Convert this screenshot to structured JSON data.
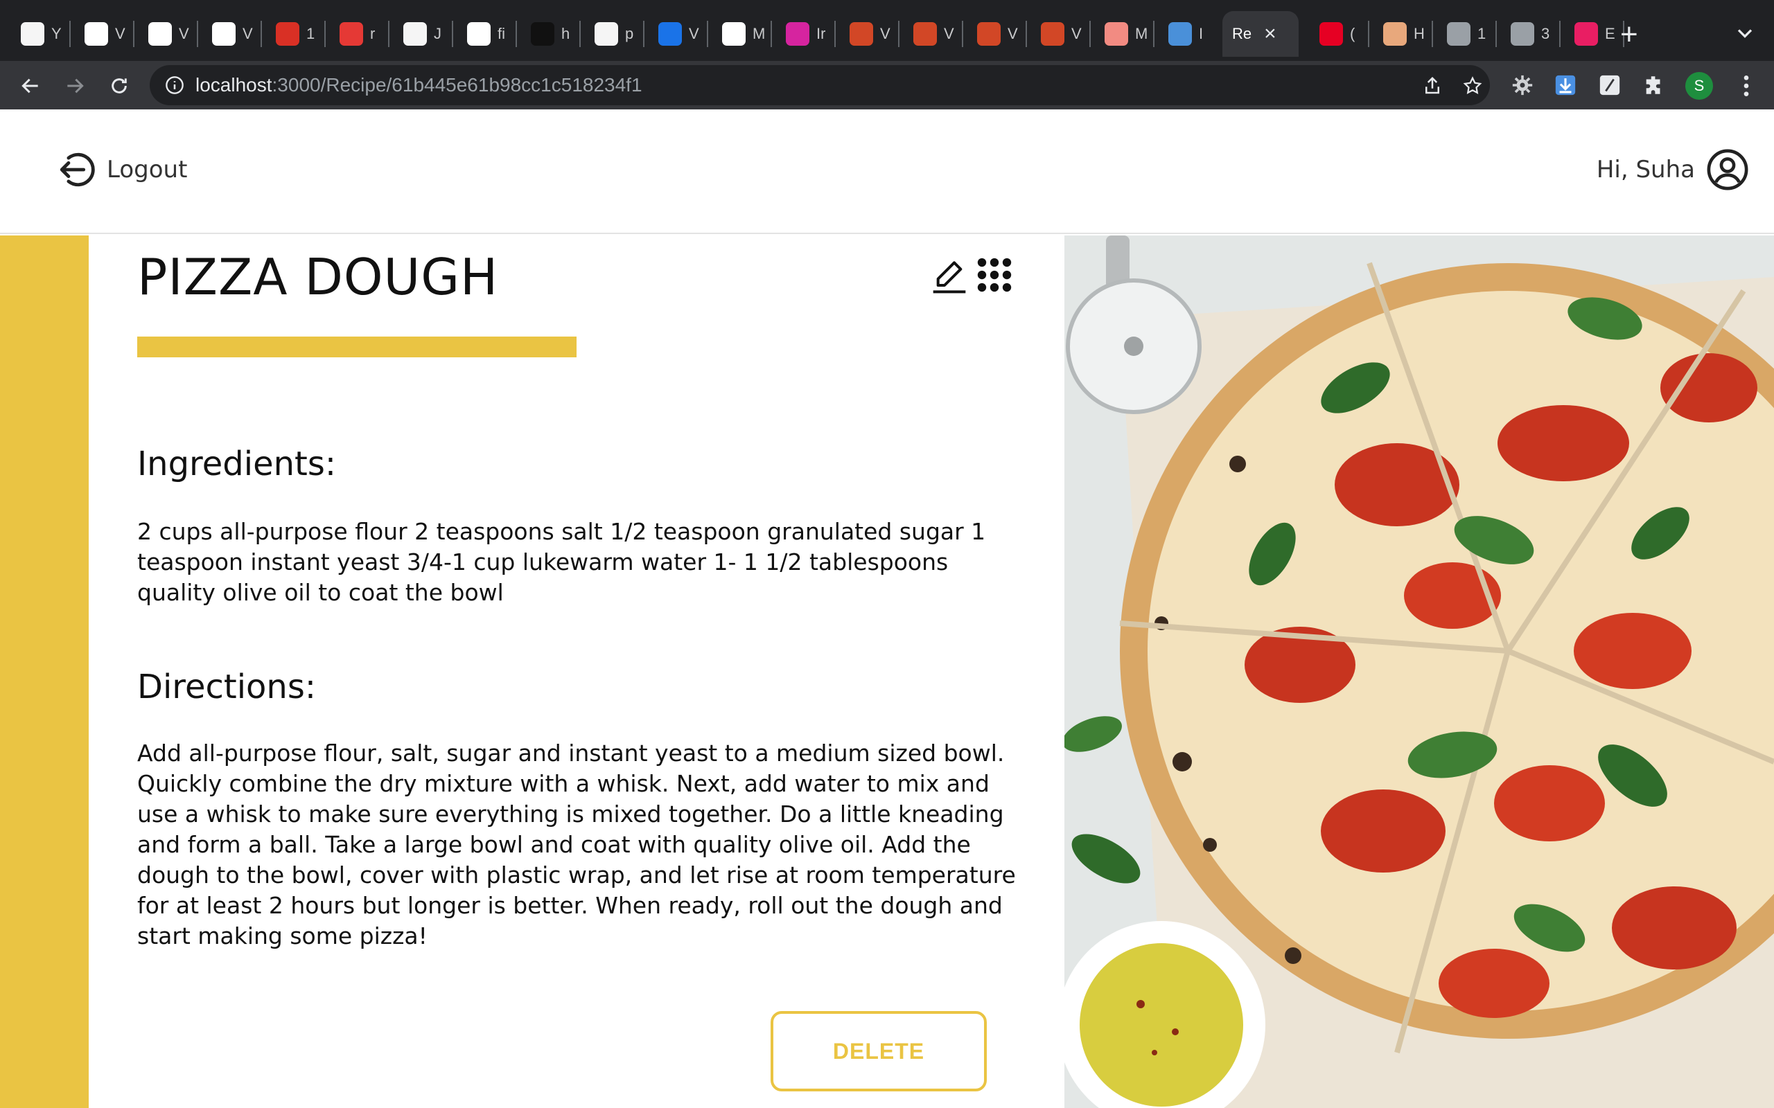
{
  "browser": {
    "tabs": [
      {
        "label": "Y",
        "icon": "github-icon",
        "color": "#f5f5f5"
      },
      {
        "label": "V",
        "icon": "wix-icon",
        "color": "#ffffff"
      },
      {
        "label": "V",
        "icon": "wix-icon",
        "color": "#ffffff"
      },
      {
        "label": "V",
        "icon": "wix-icon",
        "color": "#ffffff"
      },
      {
        "label": "1",
        "icon": "shield-icon",
        "color": "#d93025"
      },
      {
        "label": "r",
        "icon": "n-logo-icon",
        "color": "#e53935"
      },
      {
        "label": "J",
        "icon": "github-icon",
        "color": "#f5f5f5"
      },
      {
        "label": "fi",
        "icon": "figma-icon",
        "color": "#ffffff"
      },
      {
        "label": "h",
        "icon": "p-logo-icon",
        "color": "#111111"
      },
      {
        "label": "p",
        "icon": "github-icon",
        "color": "#f5f5f5"
      },
      {
        "label": "V",
        "icon": "globe-blue-icon",
        "color": "#1a73e8"
      },
      {
        "label": "M",
        "icon": "mail-icon",
        "color": "#ffffff"
      },
      {
        "label": "Ir",
        "icon": "instagram-icon",
        "color": "#d6249f"
      },
      {
        "label": "V",
        "icon": "powerpoint-icon",
        "color": "#d24726"
      },
      {
        "label": "V",
        "icon": "powerpoint-icon",
        "color": "#d24726"
      },
      {
        "label": "V",
        "icon": "powerpoint-icon",
        "color": "#d24726"
      },
      {
        "label": "V",
        "icon": "powerpoint-icon",
        "color": "#d24726"
      },
      {
        "label": "M",
        "icon": "record-icon",
        "color": "#f28b82"
      },
      {
        "label": "I",
        "icon": "chart-icon",
        "color": "#4a90d9"
      },
      {
        "label": "Re",
        "icon": "",
        "color": "#ffffff",
        "active": true
      },
      {
        "label": "(",
        "icon": "pinterest-icon",
        "color": "#e60023"
      },
      {
        "label": "H",
        "icon": "house-icon",
        "color": "#e8a87c"
      },
      {
        "label": "1",
        "icon": "globe-icon",
        "color": "#9aa0a6"
      },
      {
        "label": "3",
        "icon": "globe-icon",
        "color": "#9aa0a6"
      },
      {
        "label": "E",
        "icon": "heart-icon",
        "color": "#e91e63"
      }
    ],
    "url_host": "localhost",
    "url_path": ":3000/Recipe/61b445e61b98cc1c518234f1",
    "profile_initial": "S"
  },
  "header": {
    "logout_label": "Logout",
    "greeting": "Hi, Suha"
  },
  "recipe": {
    "title": "PIZZA DOUGH",
    "ingredients_heading": "Ingredients:",
    "ingredients_text": "2 cups all-purpose flour 2 teaspoons salt 1/2 teaspoon granulated sugar 1 teaspoon instant yeast 3/4-1 cup lukewarm water 1- 1 1/2 tablespoons quality olive oil to coat the bowl",
    "directions_heading": "Directions:",
    "directions_text": "Add all-purpose flour, salt, sugar and instant yeast to a medium sized bowl. Quickly combine the dry mixture with a whisk. Next, add water to mix and use a whisk to make sure everything is mixed together. Do a little kneading and form a ball. Take a large bowl and coat with quality olive oil. Add the dough to the bowl, cover with plastic wrap, and let rise at room temperature for at least 2 hours but longer is better. When ready, roll out the dough and start making some pizza!",
    "delete_label": "DELETE"
  },
  "colors": {
    "accent": "#eac443",
    "chrome_dark": "#202124",
    "chrome_toolbar": "#35363a"
  }
}
